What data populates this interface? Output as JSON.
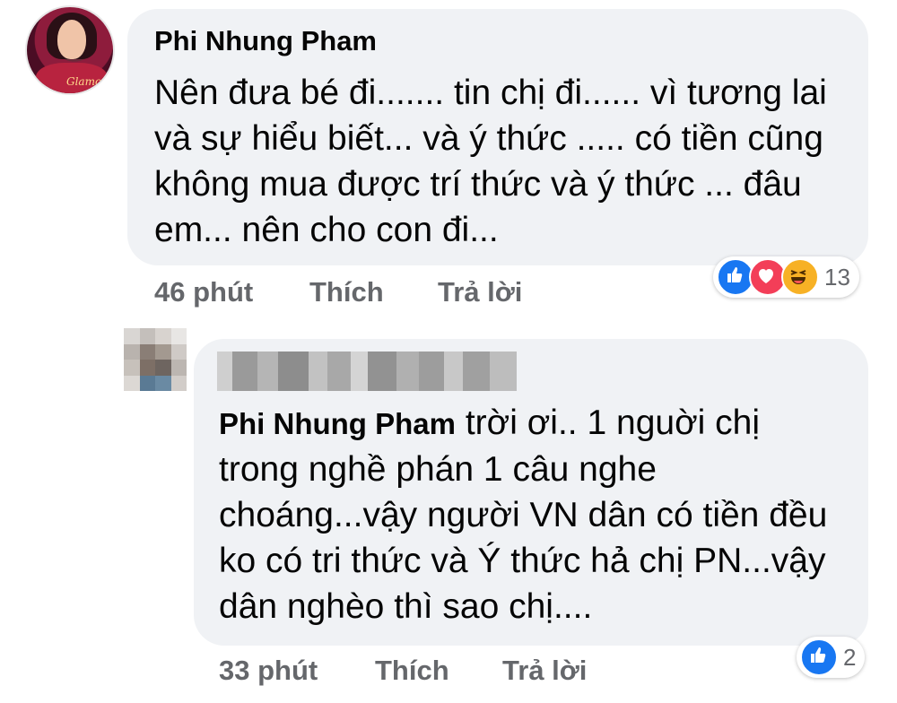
{
  "comment": {
    "author": "Phi Nhung Pham",
    "text": "Nên đưa bé đi....... tin chị đi...... vì tương lai và sự hiểu biết... và ý thức ..... có tiền cũng không mua được trí thức và ý thức ... đâu em... nên cho con đi...",
    "time": "46 phút",
    "like_label": "Thích",
    "reply_label": "Trả lời",
    "reaction_icons": [
      "like-icon",
      "love-icon",
      "haha-icon"
    ],
    "reaction_count": "13",
    "avatar_caption": "Glamour"
  },
  "reply": {
    "mention": "Phi Nhung Pham",
    "text": " trời ơi.. 1 nguời chị trong nghề phán 1 câu nghe choáng...vậy người VN dân có tiền đều ko có tri thức và Ý thức hả chị PN...vậy dân nghèo thì sao chị....",
    "time": "33 phút",
    "like_label": "Thích",
    "reply_label": "Trả lời",
    "reaction_icons": [
      "like-icon"
    ],
    "reaction_count": "2"
  },
  "colors": {
    "bubble": "#f0f2f5",
    "meta": "#65676b",
    "like": "#1877f2",
    "love": "#f33e58",
    "haha": "#f7b125"
  }
}
